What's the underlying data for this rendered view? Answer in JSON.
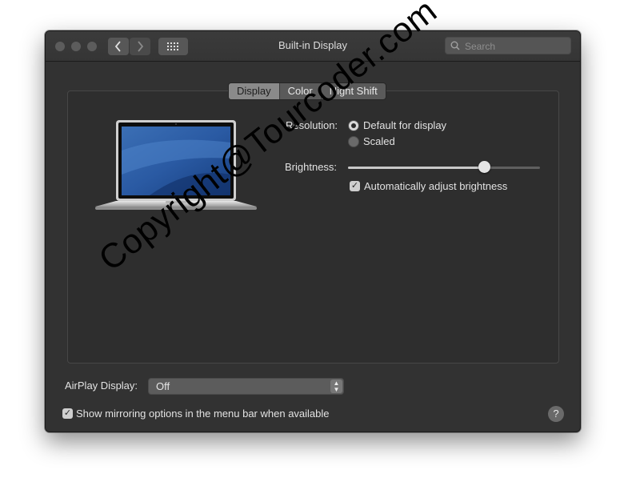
{
  "window": {
    "title": "Built-in Display",
    "search_placeholder": "Search"
  },
  "titlebar_icons": [
    "close-light",
    "minimize-light",
    "zoom-light",
    "back-chevron",
    "forward-chevron",
    "grid-icon",
    "search-icon"
  ],
  "tabs": [
    {
      "label": "Display",
      "active": true
    },
    {
      "label": "Color",
      "active": false
    },
    {
      "label": "Night Shift",
      "active": false
    }
  ],
  "display": {
    "resolution_label": "Resolution:",
    "resolution_options": [
      {
        "label": "Default for display",
        "selected": true
      },
      {
        "label": "Scaled",
        "selected": false
      }
    ],
    "brightness_label": "Brightness:",
    "brightness_level": 0.71,
    "auto_brightness_label": "Automatically adjust brightness",
    "auto_brightness_checked": true
  },
  "airplay": {
    "label": "AirPlay Display:",
    "value": "Off"
  },
  "mirroring": {
    "label": "Show mirroring options in the menu bar when available",
    "checked": true
  },
  "help_label": "?",
  "watermark": "Copyright@Tourcoder.com",
  "colors": {
    "window_bg": "#323232",
    "panel_bg": "#2e2e2e",
    "tab_active": "#8a8a8a"
  }
}
